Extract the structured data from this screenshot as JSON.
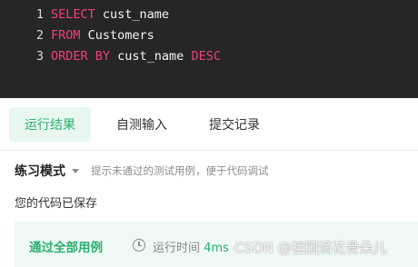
{
  "editor": {
    "lines": [
      {
        "number": "1",
        "tokens": [
          {
            "text": "SELECT",
            "type": "keyword"
          },
          {
            "text": " cust_name",
            "type": "identifier"
          }
        ]
      },
      {
        "number": "2",
        "tokens": [
          {
            "text": "FROM",
            "type": "keyword"
          },
          {
            "text": " Customers",
            "type": "identifier"
          }
        ]
      },
      {
        "number": "3",
        "tokens": [
          {
            "text": "ORDER BY",
            "type": "keyword"
          },
          {
            "text": " cust_name ",
            "type": "identifier"
          },
          {
            "text": "DESC",
            "type": "keyword"
          }
        ]
      }
    ],
    "colors": {
      "background": "#262626",
      "keyword": "#f0407c",
      "identifier": "#f4f4f4"
    }
  },
  "tabs": [
    {
      "label": "运行结果",
      "active": true
    },
    {
      "label": "自测输入",
      "active": false
    },
    {
      "label": "提交记录",
      "active": false
    }
  ],
  "mode": {
    "label": "练习模式",
    "hint": "提示未通过的测试用例，便于代码调试"
  },
  "saved_text": "您的代码已保存",
  "result": {
    "status": "通过全部用例",
    "runtime_label": "运行时间",
    "runtime_value": "4ms"
  },
  "watermark": "CSDN @祖国滴花骨朵儿",
  "colors": {
    "accent": "#2ab06f",
    "accent_bg": "#e9f7f1"
  }
}
